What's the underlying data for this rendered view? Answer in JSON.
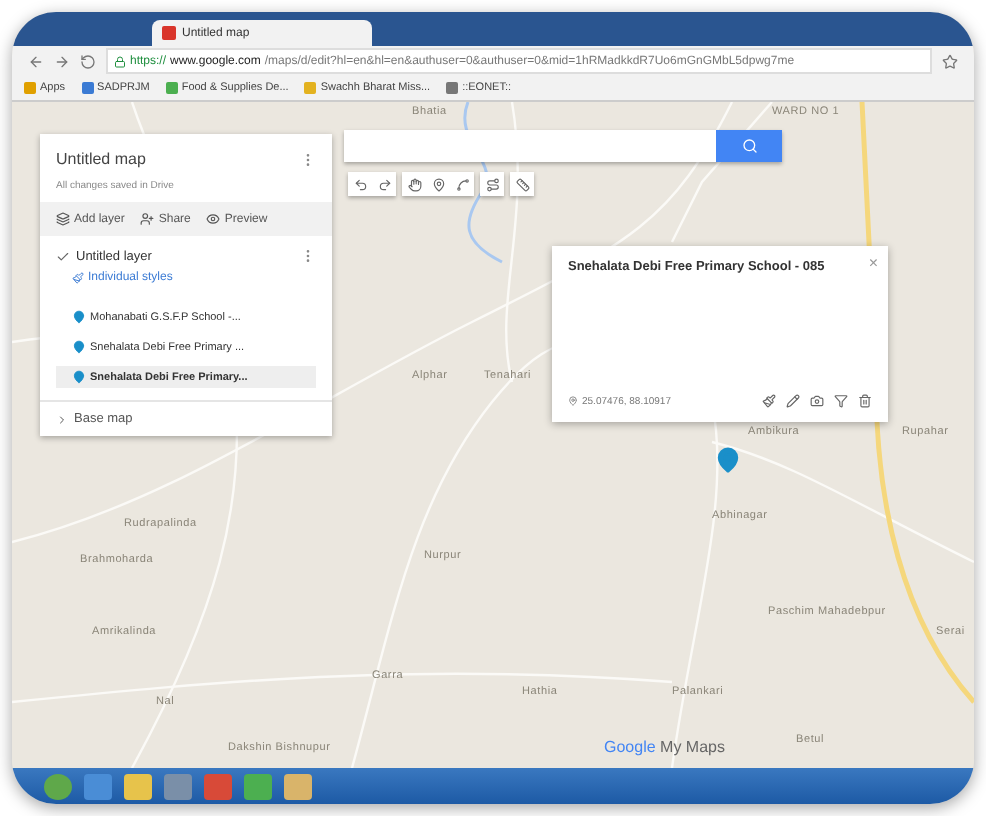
{
  "browser": {
    "tabs": [
      {
        "label": "Untitled map",
        "selected": true
      }
    ],
    "url": {
      "secure": "https://",
      "host": "www.google.com",
      "path": "/maps/d/edit?hl=en&hl=en&authuser=0&authuser=0&mid=1hRMadkkdR7Uo6mGnGMbL5dpwg7me"
    },
    "bookmarks": [
      {
        "label": "Apps"
      },
      {
        "label": "SADPRJM"
      },
      {
        "label": "Food & Supplies De..."
      },
      {
        "label": "Swachh Bharat Miss..."
      },
      {
        "label": "::EONET::"
      }
    ]
  },
  "panel": {
    "title": "Untitled map",
    "subtitle": "All changes saved in Drive",
    "actions": [
      {
        "label": "Add layer"
      },
      {
        "label": "Share"
      },
      {
        "label": "Preview"
      }
    ],
    "layer": {
      "name": "Untitled layer",
      "checked": true,
      "style": "Individual styles",
      "items": [
        {
          "label": "Mohanabati G.S.F.P School -...",
          "selected": false
        },
        {
          "label": "Snehalata Debi Free Primary ...",
          "selected": false
        },
        {
          "label": "Snehalata Debi Free Primary...",
          "selected": true
        }
      ]
    },
    "base_map": "Base map"
  },
  "info_window": {
    "title": "Snehalata Debi Free Primary School - 085",
    "coordinates": "25.07476, 88.10917",
    "close": "×"
  },
  "map_labels": [
    {
      "text": "Bhatia"
    },
    {
      "text": "WARD NO 1"
    },
    {
      "text": "Alphar"
    },
    {
      "text": "Tenahari"
    },
    {
      "text": "Ambikura"
    },
    {
      "text": "Rupahar"
    },
    {
      "text": "Rudrapalinda"
    },
    {
      "text": "Abhinagar"
    },
    {
      "text": "Brahmoharda"
    },
    {
      "text": "Nurpur"
    },
    {
      "text": "Paschim Mahadebpur"
    },
    {
      "text": "Amrikalinda"
    },
    {
      "text": "Serai"
    },
    {
      "text": "Garra"
    },
    {
      "text": "Hathia"
    },
    {
      "text": "Palankari"
    },
    {
      "text": "Nal"
    },
    {
      "text": "Dakshin Bishnupur"
    },
    {
      "text": "Betul"
    }
  ],
  "branding": {
    "word": "Google",
    "product": "My Maps"
  }
}
